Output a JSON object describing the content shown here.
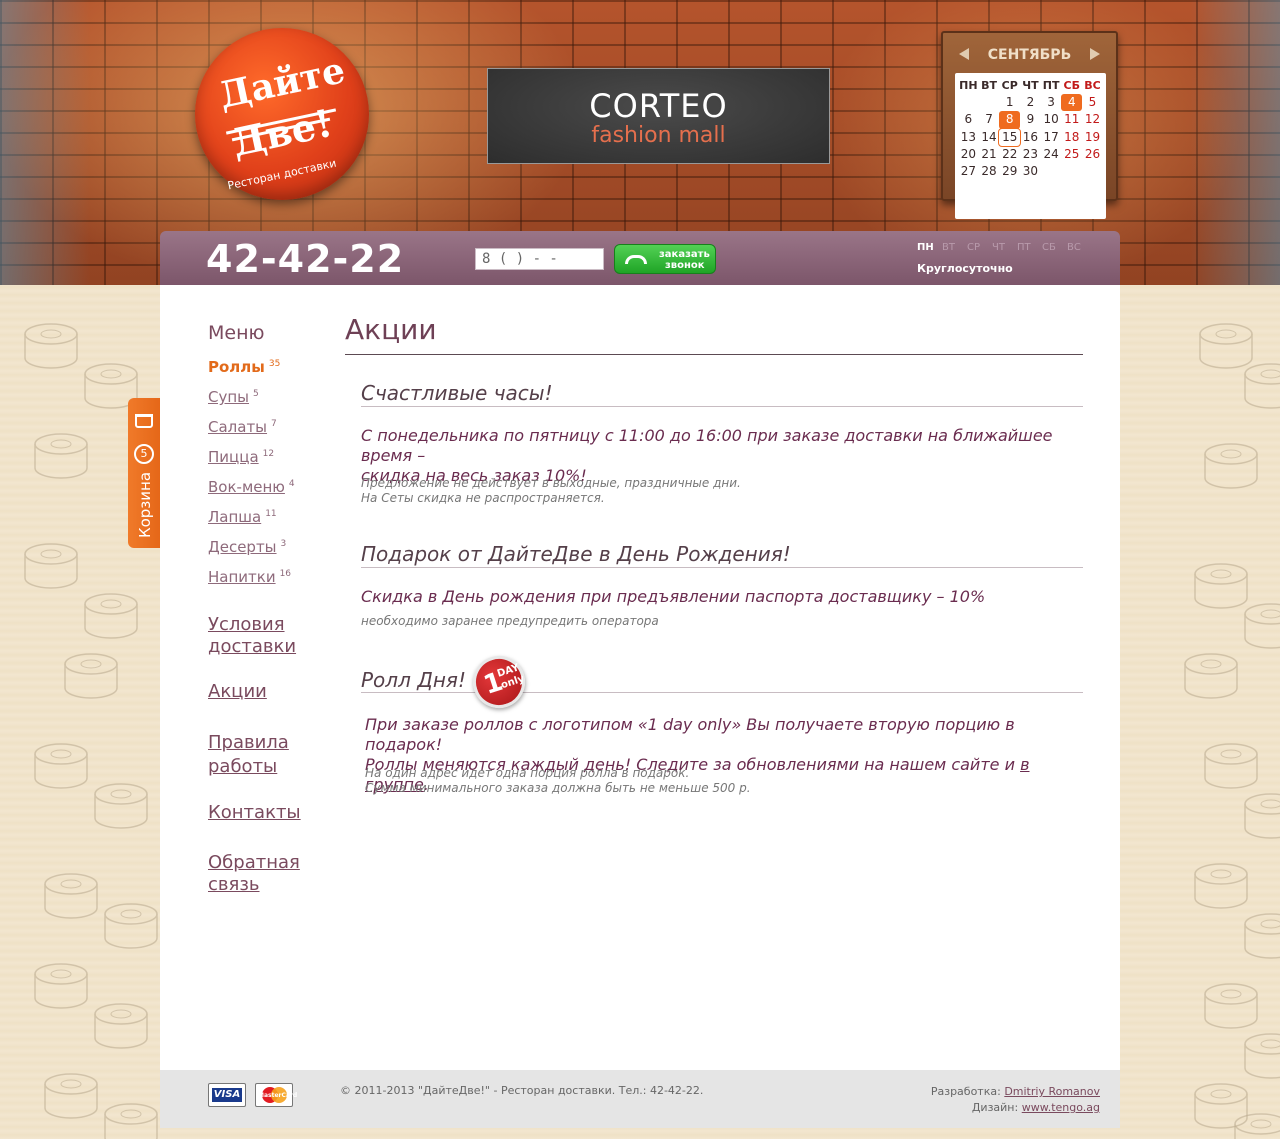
{
  "brand": {
    "logo_line1": "Дайте",
    "logo_line2": "Две!",
    "logo_tagline": "Ресторан доставки"
  },
  "banner": {
    "line1": "CORTEO",
    "line2": "fashion mall"
  },
  "calendar": {
    "month": "СЕНТЯБРЬ",
    "weekday_headers": [
      "ПН",
      "ВТ",
      "СР",
      "ЧТ",
      "ПТ",
      "СБ",
      "ВС"
    ],
    "weeks": [
      [
        "",
        "",
        "1",
        "2",
        "3",
        "4",
        "5"
      ],
      [
        "6",
        "7",
        "8",
        "9",
        "10",
        "11",
        "12"
      ],
      [
        "13",
        "14",
        "15",
        "16",
        "17",
        "18",
        "19"
      ],
      [
        "20",
        "21",
        "22",
        "23",
        "24",
        "25",
        "26"
      ],
      [
        "27",
        "28",
        "29",
        "30",
        "",
        "",
        ""
      ]
    ],
    "highlighted_days": [
      "4",
      "8"
    ],
    "today": "15",
    "accent_color": "#ef6b1f",
    "weekend_color": "#c21a1a"
  },
  "topbar": {
    "phone": "42-42-22",
    "callback_input_value": "8 (    )       -    -",
    "callback_button_line1": "заказать",
    "callback_button_line2": "звонок",
    "days": [
      "ПН",
      "ВТ",
      "СР",
      "ЧТ",
      "ПТ",
      "СБ",
      "ВС"
    ],
    "hours": "Круглосуточно"
  },
  "cart": {
    "label": "Корзина",
    "count": "5",
    "icon": "cart-icon"
  },
  "sidebar": {
    "menu_title": "Меню",
    "items": [
      {
        "label": "Роллы",
        "count": "35",
        "active": true
      },
      {
        "label": "Супы",
        "count": "5"
      },
      {
        "label": "Салаты",
        "count": "7"
      },
      {
        "label": "Пицца",
        "count": "12"
      },
      {
        "label": "Вок-меню",
        "count": "4"
      },
      {
        "label": "Лапша",
        "count": "11"
      },
      {
        "label": "Десерты",
        "count": "3"
      },
      {
        "label": "Напитки",
        "count": "16"
      }
    ],
    "links": [
      {
        "line1": "Условия",
        "line2": "доставки"
      },
      {
        "line1": "Акции",
        "line2": ""
      },
      {
        "line1": "Правила",
        "line2": "работы"
      },
      {
        "line1": "Контакты",
        "line2": ""
      },
      {
        "line1": "Обратная",
        "line2": "связь"
      }
    ]
  },
  "page": {
    "title": "Акции",
    "sections": [
      {
        "title": "Счастливые часы!",
        "lead_line1": "С понедельника по пятницу с 11:00 до 16:00 при заказе доставки на ближайшее время –",
        "lead_line2": "скидка на весь заказ 10%!",
        "note_line1": "Предложение не действует в выходные, праздничные дни.",
        "note_line2": "На Сеты скидка не распространяется."
      },
      {
        "title": "Подарок от ДайтеДве в День Рождения!",
        "lead_line1": "Скидка в День рождения при предъявлении паспорта доставщику – 10%",
        "note_line1": "необходимо заранее предупредить оператора"
      },
      {
        "title": "Ролл Дня!",
        "badge_number": "1",
        "badge_text1": "DAY",
        "badge_text2": "only",
        "lead_line1": "При заказе роллов с логотипом «1 day only» Вы получаете вторую порцию в подарок!",
        "lead_line2_pre": "Роллы меняются каждый день! Следите за обновлениями на нашем сайте и ",
        "lead_link": "в группе",
        "lead_line2_post": ".",
        "note_line1": "На один адрес идет одна порция ролла в подарок.",
        "note_line2": "Сумма минимального заказа должна быть не меньше 500 р."
      }
    ]
  },
  "footer": {
    "copyright": "© 2011-2013 \"ДайтеДве!\" - Ресторан доставки.  Тел.: 42-42-22.",
    "dev_label": "Разработка:",
    "dev_name": "Dmitriy Romanov",
    "design_label": "Дизайн:",
    "design_name": "www.tengo.ag",
    "payment_visa": "VISA",
    "payment_mc": "MasterCard"
  }
}
